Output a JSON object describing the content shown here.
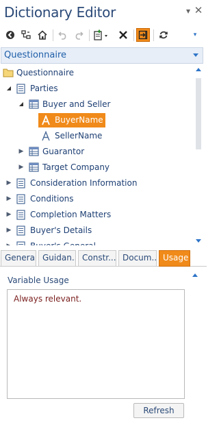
{
  "window": {
    "title": "Dictionary Editor",
    "pin_icon": "pin-dropdown-icon",
    "close_icon": "close-icon"
  },
  "toolbar": {
    "buttons": [
      {
        "icon": "back-icon",
        "enabled": true
      },
      {
        "icon": "hierarchy-icon",
        "enabled": true
      },
      {
        "icon": "home-icon",
        "enabled": true
      },
      {
        "icon": "undo-icon",
        "enabled": false
      },
      {
        "icon": "redo-icon",
        "enabled": false
      },
      {
        "icon": "new-item-dropdown-icon",
        "enabled": true
      },
      {
        "icon": "delete-icon",
        "enabled": true
      },
      {
        "icon": "dock-panel-icon",
        "enabled": true,
        "active": true
      },
      {
        "icon": "refresh-icon",
        "enabled": true
      }
    ]
  },
  "selector": {
    "value": "Questionnaire"
  },
  "tree": {
    "rows": [
      {
        "label": "Questionnaire",
        "icon": "folder-icon",
        "expander": "",
        "level": 0
      },
      {
        "label": "Parties",
        "icon": "document-icon",
        "expander": "expanded",
        "level": 1
      },
      {
        "label": "Buyer and Seller",
        "icon": "table-icon",
        "expander": "expanded",
        "level": 2
      },
      {
        "label": "BuyerName",
        "icon": "text-variable-icon",
        "expander": "",
        "level": 3,
        "selected": true
      },
      {
        "label": "SellerName",
        "icon": "text-variable-icon",
        "expander": "",
        "level": 3
      },
      {
        "label": "Guarantor",
        "icon": "table-icon",
        "expander": "collapsed",
        "level": 2
      },
      {
        "label": "Target Company",
        "icon": "table-icon",
        "expander": "collapsed",
        "level": 2
      },
      {
        "label": "Consideration Information",
        "icon": "document-icon",
        "expander": "collapsed",
        "level": 1
      },
      {
        "label": "Conditions",
        "icon": "document-icon",
        "expander": "collapsed",
        "level": 1
      },
      {
        "label": "Completion Matters",
        "icon": "document-icon",
        "expander": "collapsed",
        "level": 1
      },
      {
        "label": "Buyer's Details",
        "icon": "document-icon",
        "expander": "collapsed",
        "level": 1
      },
      {
        "label": "Buyer's General",
        "icon": "document-icon",
        "expander": "collapsed",
        "level": 1
      }
    ]
  },
  "tabs": [
    {
      "label": "General"
    },
    {
      "label": "Guidan..."
    },
    {
      "label": "Constr..."
    },
    {
      "label": "Docum..."
    },
    {
      "label": "Usage",
      "active": true
    }
  ],
  "usage": {
    "heading": "Variable Usage",
    "text": "Always relevant.",
    "refresh_label": "Refresh"
  },
  "colors": {
    "accent": "#f08a1a",
    "link_text": "#1d3f73",
    "selector_bg": "#e7eef8",
    "usage_text": "#7a1e1e"
  }
}
